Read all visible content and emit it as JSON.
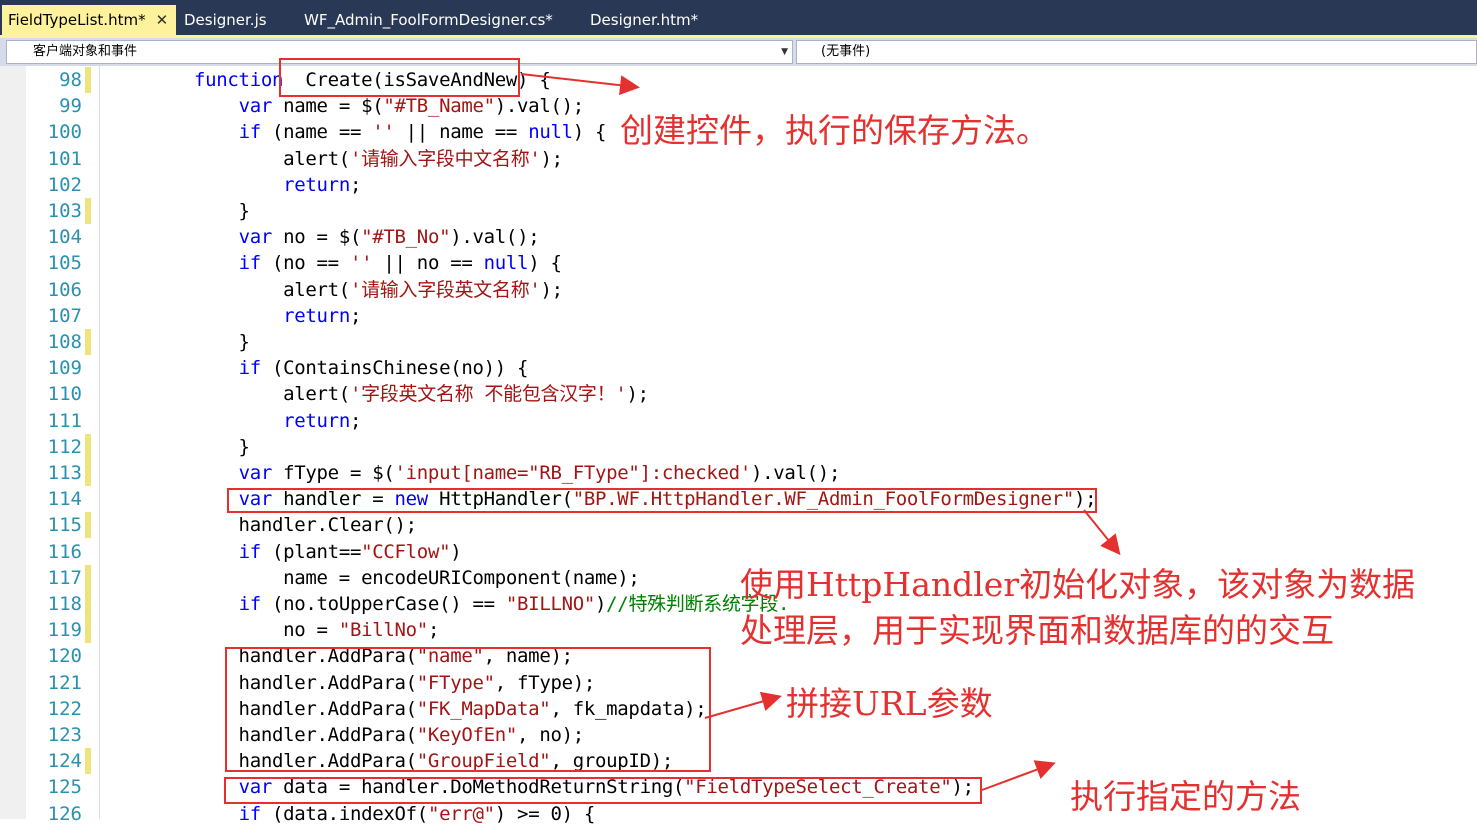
{
  "tabs": [
    {
      "label": "FieldTypeList.htm*",
      "active": true
    },
    {
      "label": "Designer.js",
      "active": false
    },
    {
      "label": "WF_Admin_FoolFormDesigner.cs*",
      "active": false
    },
    {
      "label": "Designer.htm*",
      "active": false
    }
  ],
  "toolbar": {
    "object_dropdown": "客户端对象和事件",
    "event_dropdown": "(无事件)"
  },
  "lines": [
    {
      "n": "98",
      "segs": [
        [
          "kw",
          "function"
        ],
        [
          "",
          "  Create(isSaveAndNew) {"
        ]
      ]
    },
    {
      "n": "99",
      "segs": [
        [
          "",
          "    "
        ],
        [
          "kw",
          "var"
        ],
        [
          "",
          " name = $("
        ],
        [
          "st",
          "\"#TB_Name\""
        ],
        [
          "",
          ").val();"
        ]
      ]
    },
    {
      "n": "100",
      "segs": [
        [
          "",
          "    "
        ],
        [
          "kw",
          "if"
        ],
        [
          "",
          " (name == "
        ],
        [
          "st",
          "''"
        ],
        [
          "",
          " || name == "
        ],
        [
          "kw",
          "null"
        ],
        [
          "",
          ") {"
        ]
      ]
    },
    {
      "n": "101",
      "segs": [
        [
          "",
          "        alert("
        ],
        [
          "st",
          "'请输入字段中文名称'"
        ],
        [
          "",
          ");"
        ]
      ]
    },
    {
      "n": "102",
      "segs": [
        [
          "",
          "        "
        ],
        [
          "kw",
          "return"
        ],
        [
          "",
          ";"
        ]
      ]
    },
    {
      "n": "103",
      "segs": [
        [
          "",
          "    }"
        ]
      ]
    },
    {
      "n": "104",
      "segs": [
        [
          "",
          "    "
        ],
        [
          "kw",
          "var"
        ],
        [
          "",
          " no = $("
        ],
        [
          "st",
          "\"#TB_No\""
        ],
        [
          "",
          ").val();"
        ]
      ]
    },
    {
      "n": "105",
      "segs": [
        [
          "",
          "    "
        ],
        [
          "kw",
          "if"
        ],
        [
          "",
          " (no == "
        ],
        [
          "st",
          "''"
        ],
        [
          "",
          " || no == "
        ],
        [
          "kw",
          "null"
        ],
        [
          "",
          ") {"
        ]
      ]
    },
    {
      "n": "106",
      "segs": [
        [
          "",
          "        alert("
        ],
        [
          "st",
          "'请输入字段英文名称'"
        ],
        [
          "",
          ");"
        ]
      ]
    },
    {
      "n": "107",
      "segs": [
        [
          "",
          "        "
        ],
        [
          "kw",
          "return"
        ],
        [
          "",
          ";"
        ]
      ]
    },
    {
      "n": "108",
      "segs": [
        [
          "",
          "    }"
        ]
      ]
    },
    {
      "n": "109",
      "segs": [
        [
          "",
          "    "
        ],
        [
          "kw",
          "if"
        ],
        [
          "",
          " (ContainsChinese(no)) {"
        ]
      ]
    },
    {
      "n": "110",
      "segs": [
        [
          "",
          "        alert("
        ],
        [
          "st",
          "'字段英文名称 不能包含汉字！'"
        ],
        [
          "",
          ");"
        ]
      ]
    },
    {
      "n": "111",
      "segs": [
        [
          "",
          "        "
        ],
        [
          "kw",
          "return"
        ],
        [
          "",
          ";"
        ]
      ]
    },
    {
      "n": "112",
      "segs": [
        [
          "",
          "    }"
        ]
      ]
    },
    {
      "n": "113",
      "segs": [
        [
          "",
          "    "
        ],
        [
          "kw",
          "var"
        ],
        [
          "",
          " fType = $("
        ],
        [
          "st",
          "'input[name=\"RB_FType\"]:checked'"
        ],
        [
          "",
          ").val();"
        ]
      ]
    },
    {
      "n": "114",
      "segs": [
        [
          "",
          "    "
        ],
        [
          "kw",
          "var"
        ],
        [
          "",
          " handler = "
        ],
        [
          "kw",
          "new"
        ],
        [
          "",
          " HttpHandler("
        ],
        [
          "st",
          "\"BP.WF.HttpHandler.WF_Admin_FoolFormDesigner\""
        ],
        [
          "",
          ");"
        ]
      ]
    },
    {
      "n": "115",
      "segs": [
        [
          "",
          "    handler.Clear();"
        ]
      ]
    },
    {
      "n": "116",
      "segs": [
        [
          "",
          "    "
        ],
        [
          "kw",
          "if"
        ],
        [
          "",
          " (plant=="
        ],
        [
          "st",
          "\"CCFlow\""
        ],
        [
          "",
          ")"
        ]
      ]
    },
    {
      "n": "117",
      "segs": [
        [
          "",
          "        name = encodeURIComponent(name);"
        ]
      ]
    },
    {
      "n": "118",
      "segs": [
        [
          "",
          "    "
        ],
        [
          "kw",
          "if"
        ],
        [
          "",
          " (no.toUpperCase() == "
        ],
        [
          "st",
          "\"BILLNO\""
        ],
        [
          "",
          ")"
        ],
        [
          "cm",
          "//特殊判断系统字段."
        ]
      ]
    },
    {
      "n": "119",
      "segs": [
        [
          "",
          "        no = "
        ],
        [
          "st",
          "\"BillNo\""
        ],
        [
          "",
          ";"
        ]
      ]
    },
    {
      "n": "120",
      "segs": [
        [
          "",
          "    handler.AddPara("
        ],
        [
          "st",
          "\"name\""
        ],
        [
          "",
          ", name);"
        ]
      ]
    },
    {
      "n": "121",
      "segs": [
        [
          "",
          "    handler.AddPara("
        ],
        [
          "st",
          "\"FType\""
        ],
        [
          "",
          ", fType);"
        ]
      ]
    },
    {
      "n": "122",
      "segs": [
        [
          "",
          "    handler.AddPara("
        ],
        [
          "st",
          "\"FK_MapData\""
        ],
        [
          "",
          ", fk_mapdata);"
        ]
      ]
    },
    {
      "n": "123",
      "segs": [
        [
          "",
          "    handler.AddPara("
        ],
        [
          "st",
          "\"KeyOfEn\""
        ],
        [
          "",
          ", no);"
        ]
      ]
    },
    {
      "n": "124",
      "segs": [
        [
          "",
          "    handler.AddPara("
        ],
        [
          "st",
          "\"GroupField\""
        ],
        [
          "",
          ", groupID);"
        ]
      ]
    },
    {
      "n": "125",
      "segs": [
        [
          "",
          "    "
        ],
        [
          "kw",
          "var"
        ],
        [
          "",
          " data = handler.DoMethodReturnString("
        ],
        [
          "st",
          "\"FieldTypeSelect_Create\""
        ],
        [
          "",
          ");"
        ]
      ]
    },
    {
      "n": "126",
      "segs": [
        [
          "",
          "    "
        ],
        [
          "kw",
          "if"
        ],
        [
          "",
          " (data.indexOf("
        ],
        [
          "st",
          "\"err@\""
        ],
        [
          "",
          ") >= 0) {"
        ]
      ]
    }
  ],
  "changed_lines": [
    "98",
    "103",
    "108",
    "112",
    "113",
    "115",
    "117",
    "118",
    "119",
    "124"
  ],
  "annotations": {
    "create_note": "创建控件，执行的保存方法。",
    "handler_note_line1": "使用HttpHandler初始化对象，该对象为数据",
    "handler_note_line2": "处理层，用于实现界面和数据库的的交互",
    "params_note": "拼接URL参数",
    "method_note": "执行指定的方法"
  },
  "colors": {
    "keyword": "#0000ff",
    "string": "#a31515",
    "comment": "#008000",
    "line_number": "#2b91af",
    "annotation": "#e53030",
    "tab_strip": "#293955",
    "active_tab": "#fff29d"
  }
}
